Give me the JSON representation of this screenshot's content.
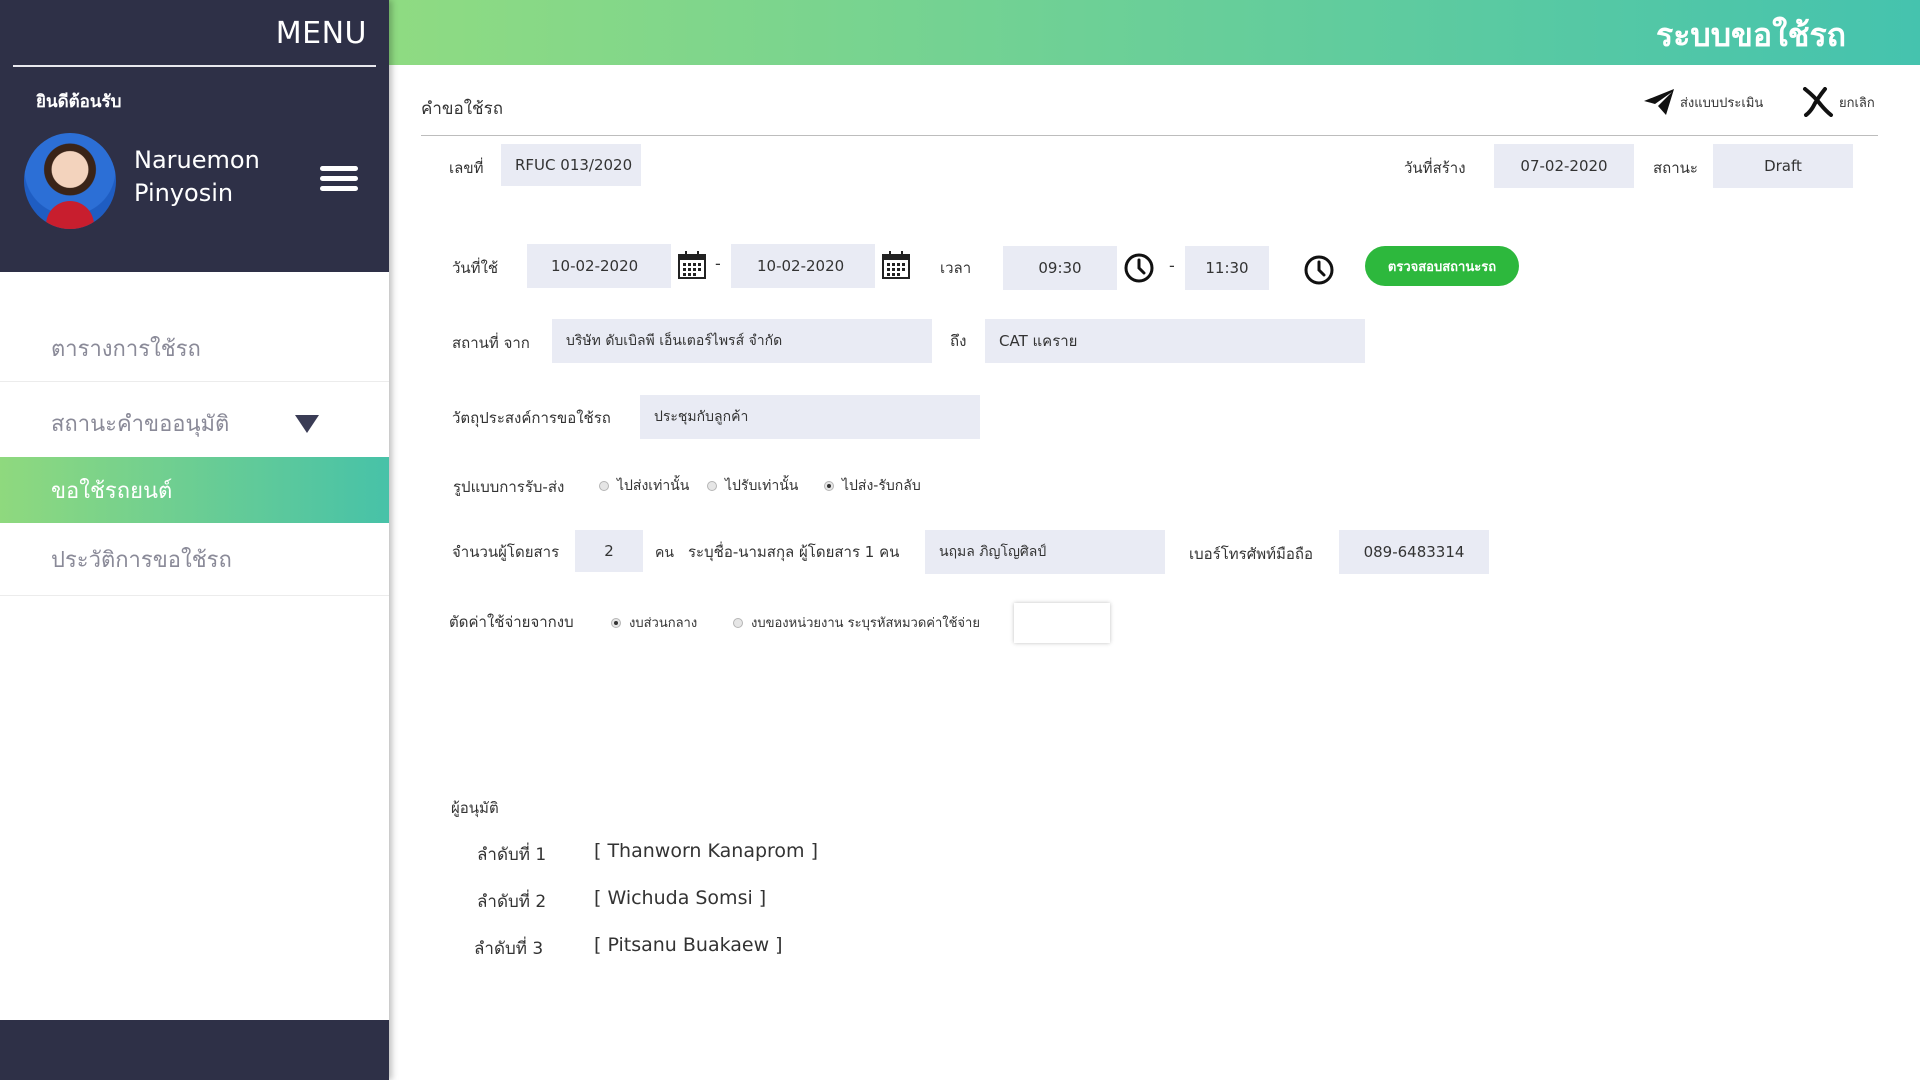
{
  "sidebar": {
    "menu_title": "MENU",
    "welcome": "ยินดีต้อนรับ",
    "user_first": "Naruemon",
    "user_last": "Pinyosin",
    "items": [
      {
        "label": "ตารางการใช้รถ"
      },
      {
        "label": "สถานะคำขออนุมัติ"
      },
      {
        "label": "ขอใช้รถยนต์"
      },
      {
        "label": "ประวัติการขอใช้รถ"
      }
    ]
  },
  "header": {
    "app_title": "ระบบขอใช้รถ"
  },
  "page": {
    "title": "คำขอใช้รถ",
    "submit_label": "ส่งแบบประเมิน",
    "cancel_label": "ยกเลิก"
  },
  "form": {
    "doc_no_label": "เลขที่",
    "doc_no": "RFUC 013/2020",
    "created_label": "วันที่สร้าง",
    "created_date": "07-02-2020",
    "status_label": "สถานะ",
    "status": "Draft",
    "use_date_label": "วันที่ใช้",
    "date_from": "10-02-2020",
    "date_to": "10-02-2020",
    "dash": "-",
    "time_label": "เวลา",
    "time_from": "09:30",
    "time_to": "11:30",
    "check_button": "ตรวจสอบสถานะรถ",
    "place_label": "สถานที่ จาก",
    "place_from": "บริษัท ดับเบิลพี เอ็นเตอร์ไพรส์ จำกัด",
    "place_to_label": "ถึง",
    "place_to": "CAT แคราย",
    "purpose_label": "วัตถุประสงค์การขอใช้รถ",
    "purpose": "ประชุมกับลูกค้า",
    "pickup_label": "รูปแบบการรับ-ส่ง",
    "pickup_options": [
      "ไปส่งเท่านั้น",
      "ไปรับเท่านั้น",
      "ไปส่ง-รับกลับ"
    ],
    "passengers_label": "จำนวนผู้โดยสาร",
    "passengers": "2",
    "person_unit": "คน",
    "passenger_name_label": "ระบุชื่อ-นามสกุล ผู้โดยสาร 1 คน",
    "passenger_name": "นฤมล ภิญโญศิลป์",
    "phone_label": "เบอร์โทรศัพท์มือถือ",
    "phone": "089-6483314",
    "budget_label": "ตัดค่าใช้จ่ายจากงบ",
    "budget_options": [
      "งบส่วนกลาง",
      "งบของหน่วยงาน ระบุรหัสหมวดค่าใช้จ่าย"
    ],
    "budget_code": ""
  },
  "approvers": {
    "label": "ผู้อนุมัติ",
    "rows": [
      {
        "order": "ลำดับที่ 1",
        "name": "[ Thanworn Kanaprom ]"
      },
      {
        "order": "ลำดับที่ 2",
        "name": "[ Wichuda Somsi ]"
      },
      {
        "order": "ลำดับที่ 3",
        "name": "[ Pitsanu Buakaew ]"
      }
    ]
  }
}
